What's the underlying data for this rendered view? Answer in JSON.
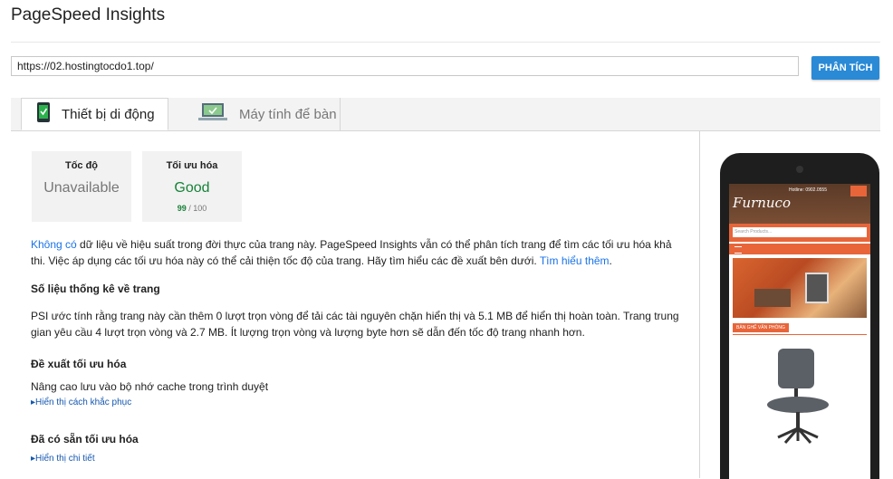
{
  "header": {
    "title": "PageSpeed Insights"
  },
  "search": {
    "url": "https://02.hostingtocdo1.top/",
    "button_label": "PHÂN TÍCH"
  },
  "tabs": [
    {
      "label": "Thiết bị di động",
      "active": true
    },
    {
      "label": "Máy tính để bàn",
      "active": false
    }
  ],
  "scores": {
    "speed": {
      "title": "Tốc độ",
      "value": "Unavailable"
    },
    "optimization": {
      "title": "Tối ưu hóa",
      "value": "Good",
      "score": "99",
      "max": "/ 100"
    }
  },
  "intro": {
    "link1": "Không có",
    "text": " dữ liệu về hiệu suất trong đời thực của trang này. PageSpeed Insights vẫn có thể phân tích trang để tìm các tối ưu hóa khả thi. Việc áp dụng các tối ưu hóa này có thể cải thiện tốc độ của trang. Hãy tìm hiểu các đề xuất bên dưới. ",
    "link2": "Tìm hiểu thêm",
    "end": "."
  },
  "stats": {
    "heading": "Số liệu thống kê về trang",
    "text": "PSI ước tính rằng trang này cần thêm 0 lượt trọn vòng để tải các tài nguyên chặn hiển thị và 5.1 MB để hiển thị hoàn toàn. Trang trung gian yêu cầu 4 lượt trọn vòng và 2.7 MB. Ít lượng trọn vòng và lượng byte hơn sẽ dẫn đến tốc độ trang nhanh hơn."
  },
  "suggestions": {
    "heading": "Đề xuất tối ưu hóa",
    "item": "Nâng cao lưu vào bộ nhớ cache trong trình duyệt",
    "toggle": "Hiển thị cách khắc phục"
  },
  "available": {
    "heading": "Đã có sẵn tối ưu hóa",
    "toggle": "Hiển thị chi tiết"
  },
  "preview": {
    "logo": "Furnuco",
    "hotline": "Hotline: 0902.0555",
    "search_placeholder": "Search Products...",
    "category": "BÀN GHẾ VĂN PHÒNG"
  },
  "colors": {
    "accent": "#2a8ad6",
    "good": "#178239",
    "link": "#1a73e8",
    "preview_orange": "#e8653a"
  }
}
